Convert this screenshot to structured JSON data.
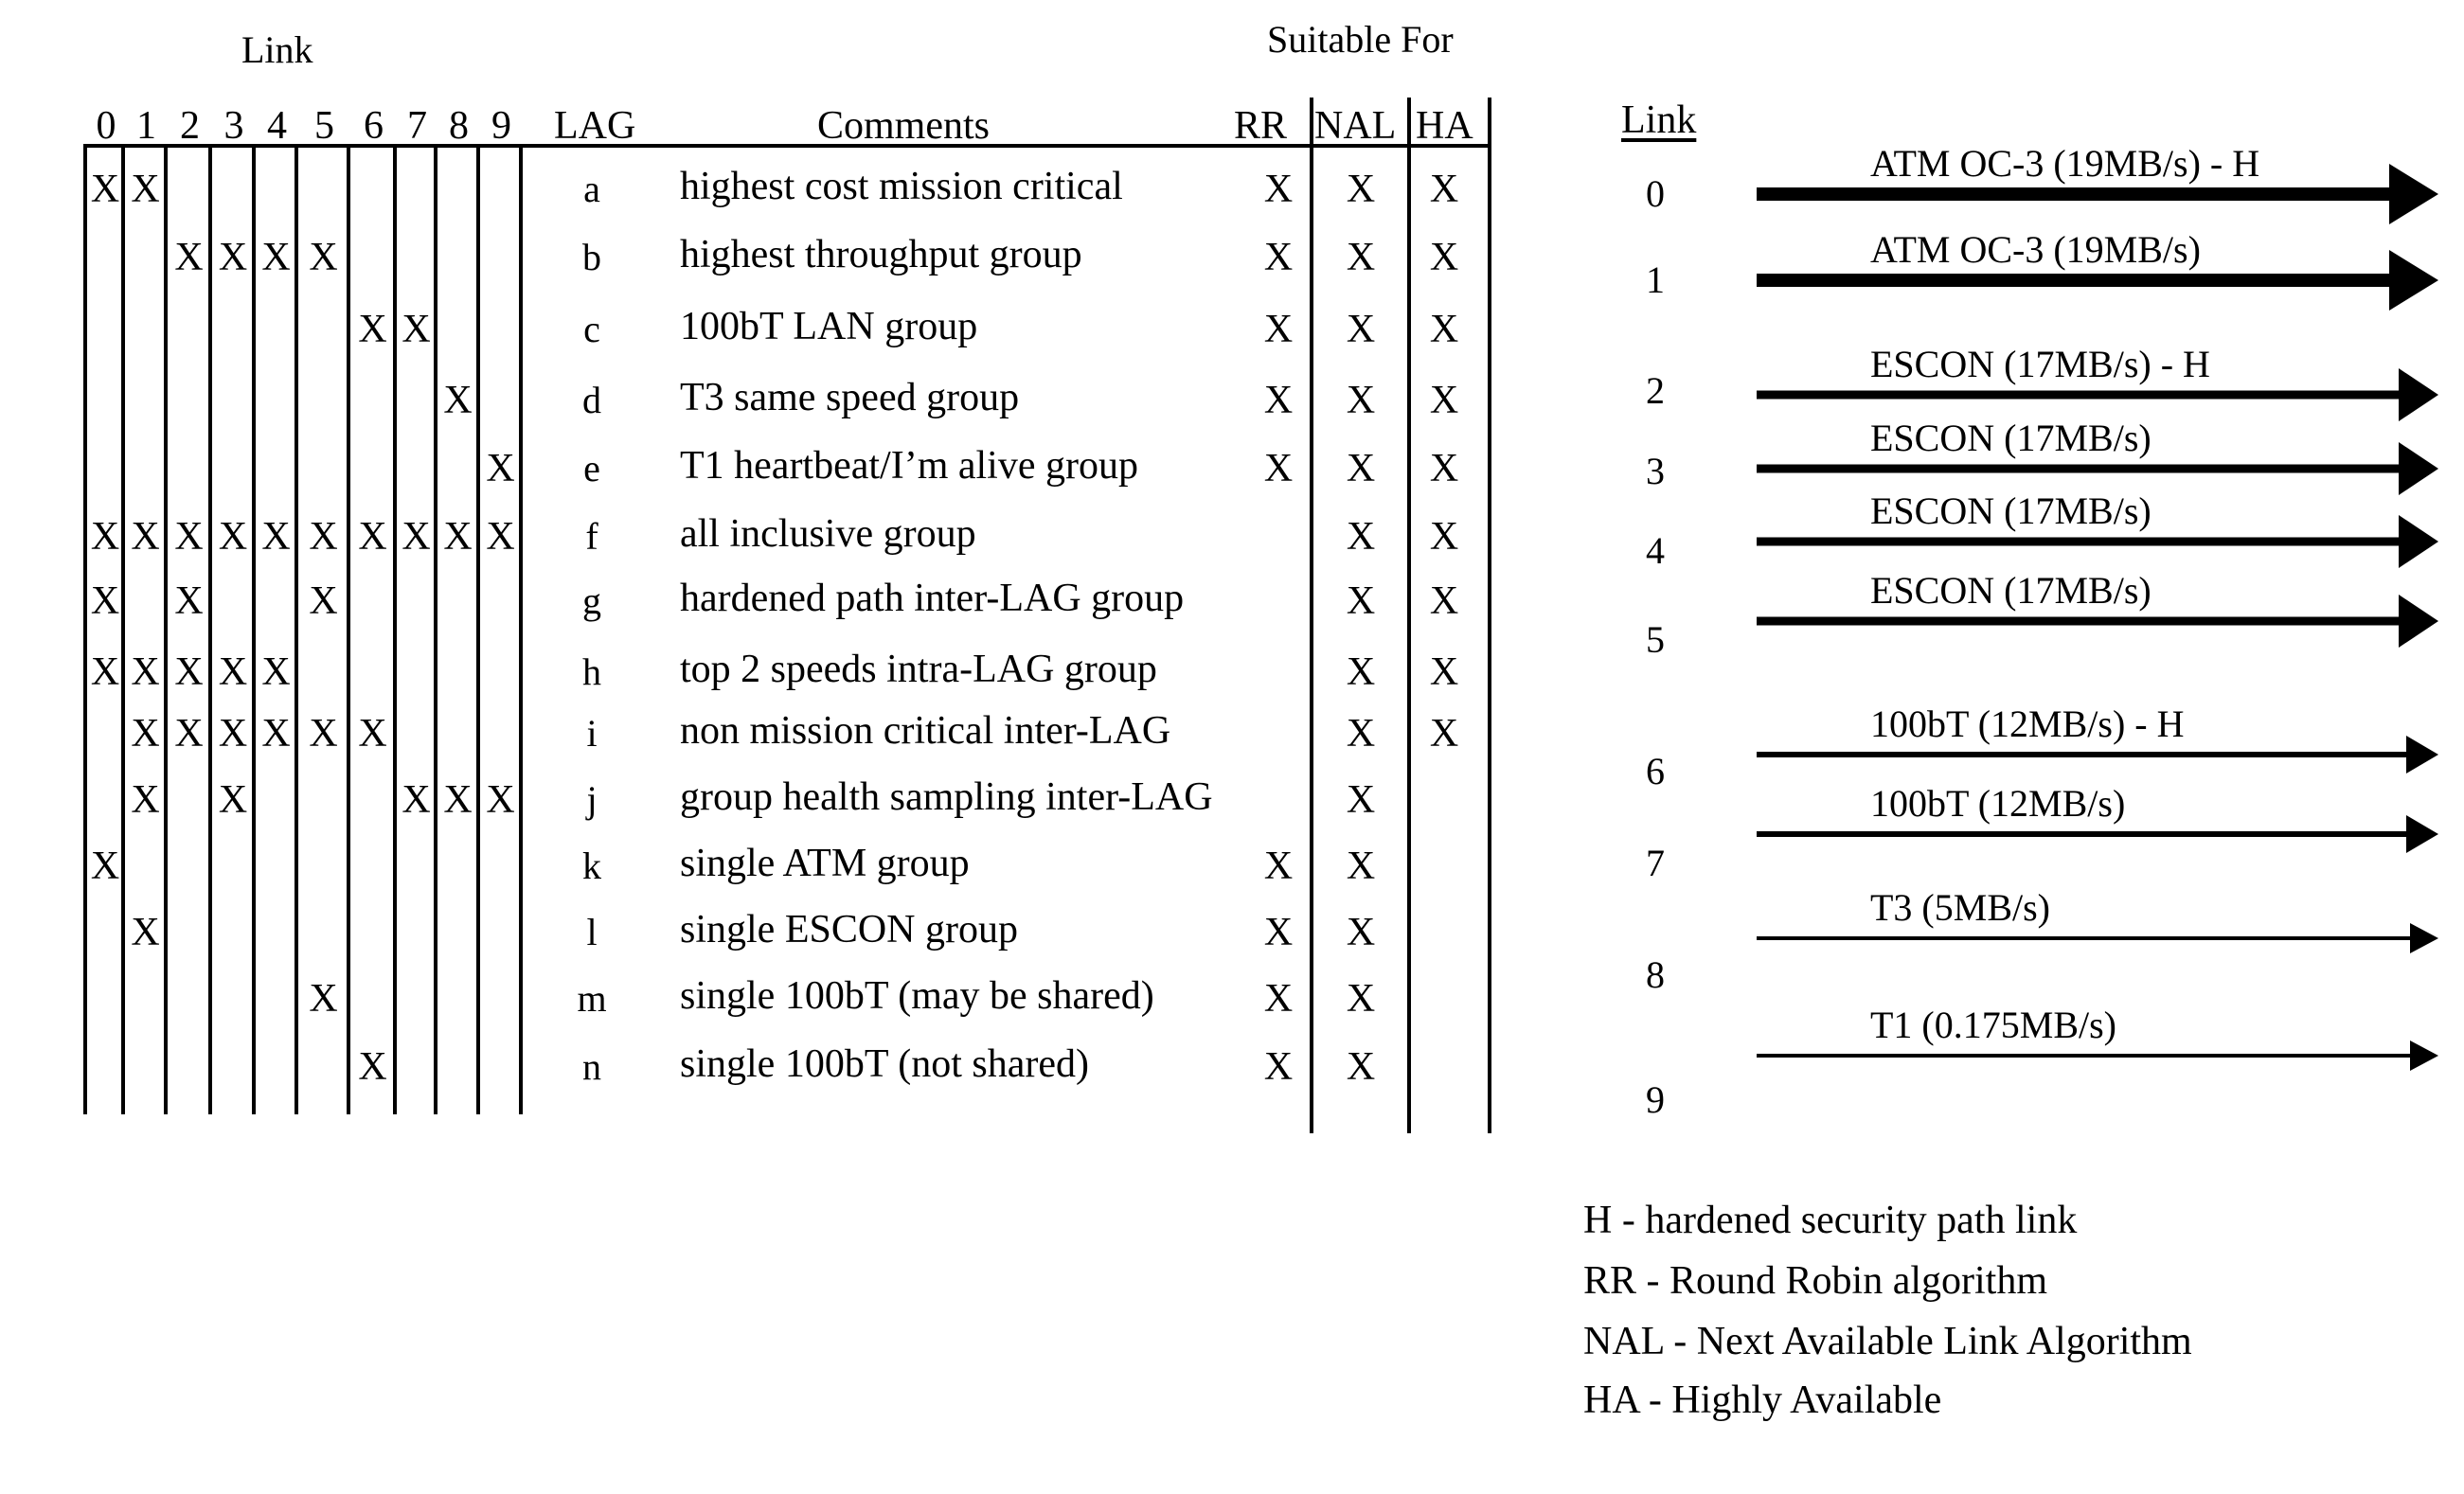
{
  "headers": {
    "link_group": "Link",
    "suitable_for": "Suitable For",
    "link_columns": [
      "0",
      "1",
      "2",
      "3",
      "4",
      "5",
      "6",
      "7",
      "8",
      "9"
    ],
    "lag": "LAG",
    "comments": "Comments",
    "algorithms": [
      "RR",
      "NAL",
      "HA"
    ]
  },
  "mark_symbol": "X",
  "rows": [
    {
      "lag": "a",
      "comment": "highest cost mission critical",
      "links": [
        0,
        1
      ],
      "rr": true,
      "nal": true,
      "ha": true
    },
    {
      "lag": "b",
      "comment": "highest throughput group",
      "links": [
        2,
        3,
        4,
        5
      ],
      "rr": true,
      "nal": true,
      "ha": true
    },
    {
      "lag": "c",
      "comment": "100bT LAN group",
      "links": [
        6,
        7
      ],
      "rr": true,
      "nal": true,
      "ha": true
    },
    {
      "lag": "d",
      "comment": "T3 same speed group",
      "links": [
        8
      ],
      "rr": true,
      "nal": true,
      "ha": true
    },
    {
      "lag": "e",
      "comment": "T1 heartbeat/I’m alive group",
      "links": [
        9
      ],
      "rr": true,
      "nal": true,
      "ha": true
    },
    {
      "lag": "f",
      "comment": "all inclusive group",
      "links": [
        0,
        1,
        2,
        3,
        4,
        5,
        6,
        7,
        8,
        9
      ],
      "rr": false,
      "nal": true,
      "ha": true
    },
    {
      "lag": "g",
      "comment": "hardened path inter-LAG group",
      "links": [
        0,
        2,
        5
      ],
      "rr": false,
      "nal": true,
      "ha": true
    },
    {
      "lag": "h",
      "comment": "top 2 speeds intra-LAG group",
      "links": [
        0,
        1,
        2,
        3,
        4
      ],
      "rr": false,
      "nal": true,
      "ha": true
    },
    {
      "lag": "i",
      "comment": "non mission critical inter-LAG",
      "links": [
        1,
        2,
        3,
        4,
        5,
        6
      ],
      "rr": false,
      "nal": true,
      "ha": true
    },
    {
      "lag": "j",
      "comment": "group health sampling inter-LAG",
      "links": [
        1,
        3,
        7,
        8,
        9
      ],
      "rr": false,
      "nal": true,
      "ha": false
    },
    {
      "lag": "k",
      "comment": "single ATM group",
      "links": [
        0
      ],
      "rr": true,
      "nal": true,
      "ha": false
    },
    {
      "lag": "l",
      "comment": "single ESCON group",
      "links": [
        1
      ],
      "rr": true,
      "nal": true,
      "ha": false
    },
    {
      "lag": "m",
      "comment": "single 100bT (may be shared)",
      "links": [
        5
      ],
      "rr": true,
      "nal": true,
      "ha": false
    },
    {
      "lag": "n",
      "comment": "single 100bT (not shared)",
      "links": [
        6
      ],
      "rr": true,
      "nal": true,
      "ha": false
    }
  ],
  "link_legend": {
    "title": "Link",
    "links": [
      {
        "id": "0",
        "label": "ATM OC-3 (19MB/s) - H",
        "weight": "heavy"
      },
      {
        "id": "1",
        "label": "ATM OC-3 (19MB/s)",
        "weight": "heavy"
      },
      {
        "id": "2",
        "label": "ESCON (17MB/s) - H",
        "weight": "medium"
      },
      {
        "id": "3",
        "label": "ESCON (17MB/s)",
        "weight": "medium"
      },
      {
        "id": "4",
        "label": "ESCON (17MB/s)",
        "weight": "medium"
      },
      {
        "id": "5",
        "label": "ESCON (17MB/s)",
        "weight": "medium"
      },
      {
        "id": "6",
        "label": "100bT (12MB/s) - H",
        "weight": "light"
      },
      {
        "id": "7",
        "label": "100bT (12MB/s)",
        "weight": "light"
      },
      {
        "id": "8",
        "label": "T3 (5MB/s)",
        "weight": "thin"
      },
      {
        "id": "9",
        "label": "T1 (0.175MB/s)",
        "weight": "thin"
      }
    ]
  },
  "abbreviations": [
    "H - hardened security path link",
    "RR - Round Robin algorithm",
    "NAL - Next Available Link Algorithm",
    "HA - Highly Available"
  ]
}
